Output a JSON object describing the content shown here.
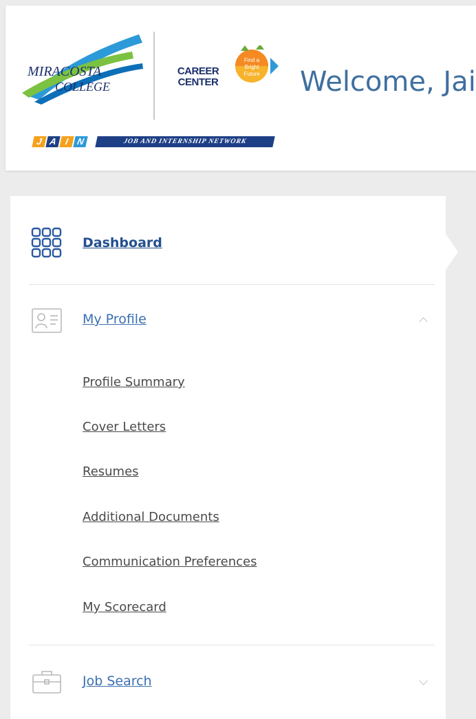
{
  "header": {
    "welcome_text": "Welcome, Jain",
    "college_logo_text_line1": "MIRACOSTA",
    "college_logo_text_line2": "COLLEGE",
    "career_center_line1": "CAREER",
    "career_center_line2": "CENTER",
    "tagline": "Find a Bright Future",
    "jain_letters": [
      "J",
      "A",
      "I",
      "N"
    ],
    "jain_network": "JOB AND INTERNSHIP NETWORK"
  },
  "nav": {
    "dashboard": {
      "label": "Dashboard",
      "icon": "grid-icon"
    },
    "my_profile": {
      "label": "My Profile",
      "icon": "profile-icon",
      "expanded": true
    },
    "profile_submenu": [
      "Profile Summary",
      "Cover Letters",
      "Resumes",
      "Additional Documents",
      "Communication Preferences",
      "My Scorecard"
    ],
    "job_search": {
      "label": "Job Search",
      "icon": "briefcase-icon",
      "expanded": false
    }
  },
  "colors": {
    "primary_blue": "#2a5aa0",
    "link_gray": "#4a4a4a",
    "welcome_blue": "#3f6f9f",
    "jain_network_bg": "#1d3f86"
  }
}
